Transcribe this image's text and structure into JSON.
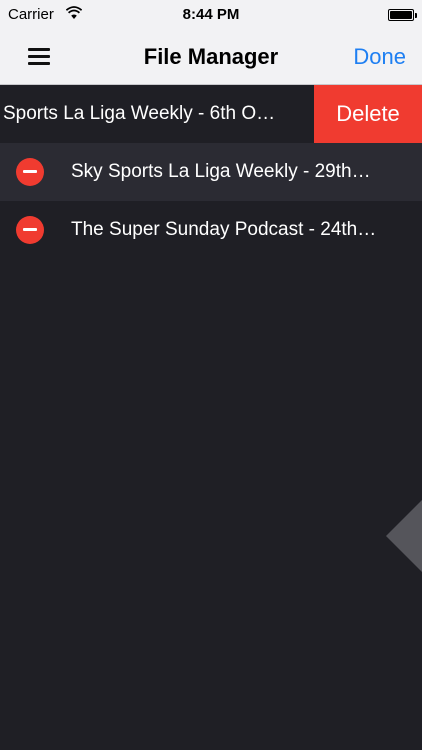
{
  "status_bar": {
    "carrier": "Carrier",
    "time": "8:44 PM",
    "battery_level": 1.0
  },
  "nav": {
    "title": "File Manager",
    "done_label": "Done",
    "menu_icon": "hamburger-icon"
  },
  "files": {
    "swiped": {
      "label": "Sports La Liga Weekly - 6th O…",
      "delete_label": "Delete"
    },
    "items": [
      {
        "label": "Sky Sports La Liga Weekly - 29th…"
      },
      {
        "label": "The Super Sunday Podcast - 24th…"
      }
    ]
  },
  "colors": {
    "background": "#1f1f25",
    "delete_red": "#f03b30",
    "done_blue": "#1e7ff2",
    "bar_background": "#f2f2f4"
  }
}
